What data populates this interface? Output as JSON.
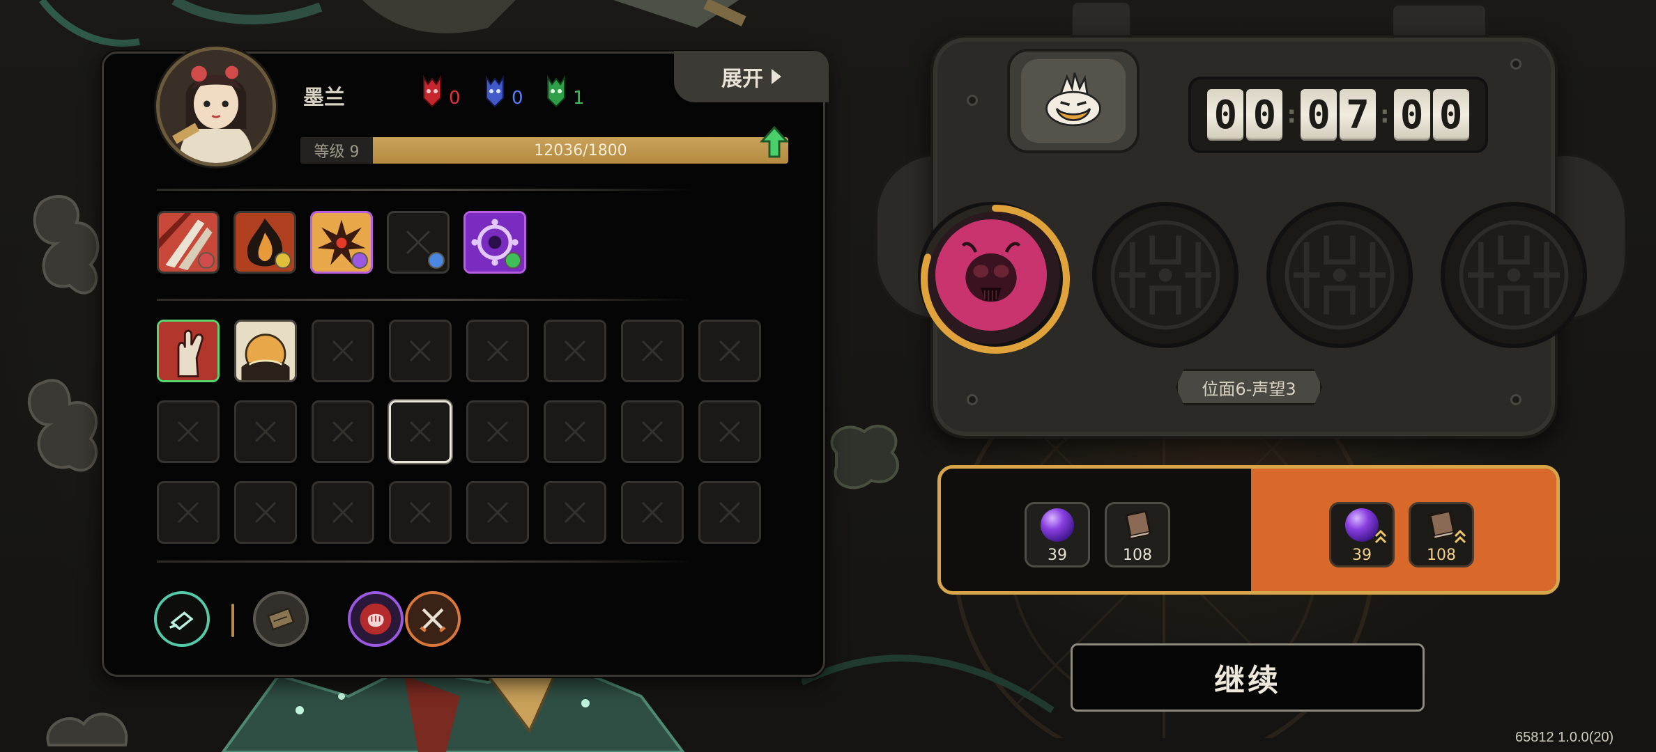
{
  "character": {
    "name": "墨兰",
    "expand_label": "展开",
    "factions": [
      {
        "id": "red",
        "value": "0",
        "color": "#e0333b"
      },
      {
        "id": "blue",
        "value": "0",
        "color": "#4f6ee0"
      },
      {
        "id": "green",
        "value": "1",
        "color": "#3fbf5a"
      }
    ],
    "level_label": "等级 9",
    "exp_text": "12036/1800",
    "exp_fill_fraction": 1.0
  },
  "skills": [
    {
      "name": "claw-slash-skill",
      "state": "owned",
      "rarity": "normal",
      "badge": "red"
    },
    {
      "name": "flame-burst-skill",
      "state": "owned",
      "rarity": "normal",
      "badge": "yellow"
    },
    {
      "name": "explosion-skill",
      "state": "owned",
      "rarity": "epic",
      "badge": "purple"
    },
    {
      "name": "empty-skill-slot",
      "state": "empty",
      "rarity": "normal",
      "badge": "blue"
    },
    {
      "name": "purple-gear-skill",
      "state": "owned",
      "rarity": "epic",
      "badge": "green"
    }
  ],
  "inventory": {
    "rows": 3,
    "cols": 8,
    "items": [
      {
        "index": 0,
        "state": "item",
        "name": "hand-relic",
        "border": "green"
      },
      {
        "index": 1,
        "state": "item",
        "name": "sun-relic",
        "border": "normal"
      },
      {
        "index": 11,
        "state": "selected"
      }
    ]
  },
  "loadout": [
    {
      "name": "dash-icon",
      "ring": "#55c9a8"
    },
    {
      "name": "scroll-icon",
      "ring": "#5a5750"
    },
    {
      "name": "fist-icon",
      "ring": "#9a59e0"
    },
    {
      "name": "crossed-swords-icon",
      "ring": "#d9783a"
    }
  ],
  "timer": {
    "digits": [
      "0",
      "0",
      "0",
      "7",
      "0",
      "0"
    ]
  },
  "opponent_slots": [
    {
      "state": "active",
      "progress": 0.8
    },
    {
      "state": "locked"
    },
    {
      "state": "locked"
    },
    {
      "state": "locked"
    }
  ],
  "tier_label": "位面6-声望3",
  "rewards": {
    "normal": [
      {
        "icon": "purple-orb",
        "qty": "39"
      },
      {
        "icon": "book",
        "qty": "108"
      }
    ],
    "boosted": [
      {
        "icon": "purple-orb",
        "qty": "39"
      },
      {
        "icon": "book",
        "qty": "108"
      }
    ]
  },
  "continue_label": "继续",
  "version": "65812 1.0.0(20)",
  "colors": {
    "gold": "#d8a64a",
    "orange": "#d8692b",
    "panel": "#050505",
    "boss_pink": "#c9346f"
  }
}
